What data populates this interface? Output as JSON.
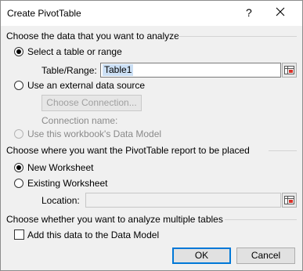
{
  "window": {
    "title": "Create PivotTable",
    "help_glyph": "?",
    "close_glyph": "✕"
  },
  "section1": {
    "heading": "Choose the data that you want to analyze",
    "radio_table": "Select a table or range",
    "table_range_label": "Table/Range:",
    "table_range_value": "Table1",
    "radio_external": "Use an external data source",
    "choose_connection": "Choose Connection...",
    "connection_name_label": "Connection name:",
    "radio_data_model": "Use this workbook's Data Model"
  },
  "section2": {
    "heading": "Choose where you want the PivotTable report to be placed",
    "radio_new": "New Worksheet",
    "radio_existing": "Existing Worksheet",
    "location_label": "Location:",
    "location_value": ""
  },
  "section3": {
    "heading": "Choose whether you want to analyze multiple tables",
    "add_data_model": "Add this data to the Data Model"
  },
  "buttons": {
    "ok": "OK",
    "cancel": "Cancel"
  },
  "icons": {
    "help": "help-icon",
    "close": "close-icon",
    "range": "range-select-icon"
  }
}
